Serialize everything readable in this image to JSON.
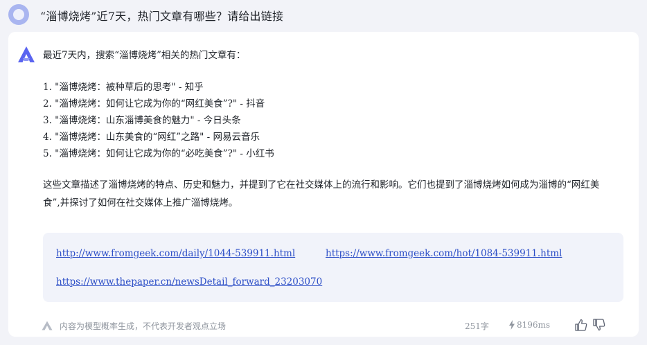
{
  "question": "“淄博烧烤”近7天，热门文章有哪些？请给出链接",
  "answer": {
    "intro": "最近7天内，搜索“淄博烧烤”相关的热门文章有：",
    "items": [
      "1. \"淄博烧烤：被种草后的思考\" - 知乎",
      "2. \"淄博烧烤：如何让它成为你的“网红美食”?\" - 抖音",
      "3. \"淄博烧烤：山东淄博美食的魅力\" - 今日头条",
      "4. \"淄博烧烤：山东美食的“网红”之路\" - 网易云音乐",
      "5. \"淄博烧烤：如何让它成为你的“必吃美食”?\" - 小红书"
    ],
    "summary": "这些文章描述了淄博烧烤的特点、历史和魅力，并提到了它在社交媒体上的流行和影响。它们也提到了淄博烧烤如何成为淄博的“网红美食”,并探讨了如何在社交媒体上推广淄博烧烤。"
  },
  "links": [
    "http://www.fromgeek.com/daily/1044-539911.html",
    "https://www.fromgeek.com/hot/1084-539911.html",
    "https://www.thepaper.cn/newsDetail_forward_23203070"
  ],
  "footer": {
    "disclaimer": "内容为模型概率生成，不代表开发者观点立场",
    "word_count": "251字",
    "latency": "8196ms"
  },
  "colors": {
    "brand": "#5a64f0",
    "link": "#2d4fc7",
    "avatar": "#a9b5f0"
  },
  "icons": [
    "user-avatar",
    "bot-logo-icon",
    "model-logo-icon",
    "bolt-icon",
    "thumbs-up-icon",
    "thumbs-down-icon"
  ]
}
